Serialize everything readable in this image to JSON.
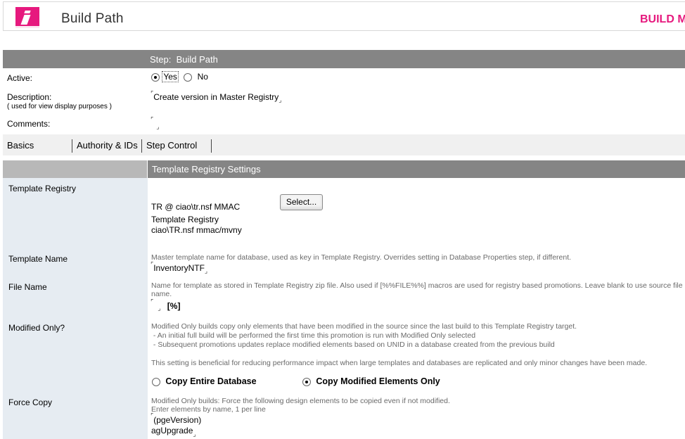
{
  "header": {
    "title": "Build Path",
    "brand": "BUILD M"
  },
  "step": {
    "label": "Step:  Build Path"
  },
  "fields": {
    "active_label": "Active:",
    "active_yes": "Yes",
    "active_no": "No",
    "active_selected": "Yes",
    "description_label": "Description:",
    "description_hint": "( used for view display purposes )",
    "description_value": "Create version in Master Registry",
    "comments_label": "Comments:",
    "comments_value": ""
  },
  "tabs": [
    {
      "label": "Basics",
      "active": true
    },
    {
      "label": "Authority & IDs",
      "active": false
    },
    {
      "label": "Step Control",
      "active": false
    }
  ],
  "section": {
    "title": "Template Registry Settings"
  },
  "template_registry": {
    "label": "Template Registry",
    "line1": "TR @ ciao\\tr.nsf MMAC",
    "line2": "Template Registry",
    "line3": "ciao\\TR.nsf  mmac/mvny",
    "select_button": "Select..."
  },
  "template_name": {
    "label": "Template Name",
    "help": "Master template name for database, used as key in Template Registry.  Overrides setting in Database Properties step, if different.",
    "value": "InventoryNTF"
  },
  "file_name": {
    "label": "File Name",
    "help": "Name for template as stored in Template Registry zip file.  Also used if [%%FILE%%] macros are used for registry based promotions.  Leave blank to use source file name.",
    "value": "",
    "suffix": "[%]"
  },
  "modified_only": {
    "label": "Modified Only?",
    "help1": "Modified Only builds copy only  elements that have been modified in the source since the last build to this Template Registry target.",
    "help2": " - An initial full build will be performed the first time this promotion is run with Modified Only selected",
    "help3": " - Subsequent promotions updates replace modified elements based on UNID in a database created from the previous build",
    "help4": "This setting is beneficial for  reducing performance impact when large templates and databases are replicated and only minor changes have been made.",
    "option_full": "Copy Entire Database",
    "option_modified": "Copy Modified Elements Only",
    "selected": "Copy Modified Elements Only"
  },
  "force_copy": {
    "label": "Force Copy",
    "help1": "Modified Only builds:  Force the following design elements to be copied even if not modified.",
    "help2": "Enter elements by name, 1 per line",
    "value1": "(pgeVersion)",
    "value2": "agUpgrade"
  }
}
